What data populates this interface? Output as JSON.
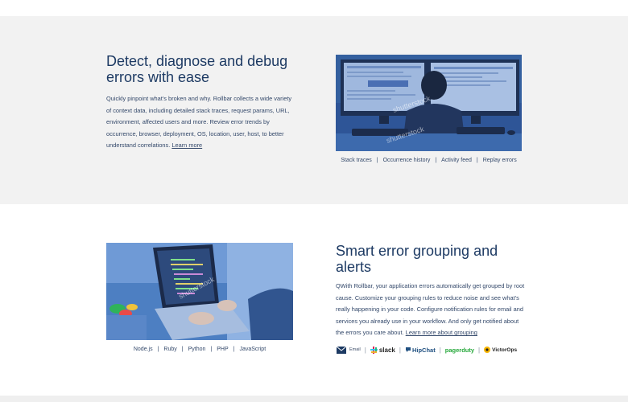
{
  "section1": {
    "title": "Detect, diagnose and debug errors with ease",
    "description": "Quickly pinpoint what's broken and why. Rollbar collects a wide variety of context data, including detailed stack traces, request params, URL, environment, affected users and more. Review error trends by occurrence, browser, deployment, OS, location, user, host, to better understand correlations.",
    "learn_more": "Learn more",
    "image_watermarks": [
      "shutterstock",
      "shutterstock"
    ],
    "tabs": [
      "Stack traces",
      "Occurrence history",
      "Activity feed",
      "Replay errors"
    ]
  },
  "section2": {
    "title": "Smart error grouping and alerts",
    "description": "With Rollbar, your application errors automatically get grouped by root cause. Customize your grouping rules to reduce noise and see what's really happening in your code. Configure notification rules for email and services you already use in your workflow. And only get notified about the errors you care about.",
    "description_prefix": "Q",
    "learn_more": "Learn more about grouping",
    "image_watermark": "shutterstock",
    "languages": [
      "Node.js",
      "Ruby",
      "Python",
      "PHP",
      "JavaScript"
    ],
    "integrations": {
      "email": "Email",
      "slack": "slack",
      "hipchat": "HipChat",
      "pagerduty": "pagerduty",
      "victorops": "VictorOps"
    }
  },
  "separator": "|",
  "colors": {
    "heading": "#1d3a63",
    "body_text": "#33486a",
    "section1_bg": "#f2f2f2",
    "photo_tint": "#2e5597",
    "slack_accent": "#e01e5a",
    "hipchat": "#205081",
    "pagerduty": "#25a83a",
    "victorops": "#f7b500"
  },
  "icons": [
    "email-icon",
    "slack-icon",
    "hipchat-icon",
    "pagerduty-icon",
    "victorops-icon"
  ]
}
